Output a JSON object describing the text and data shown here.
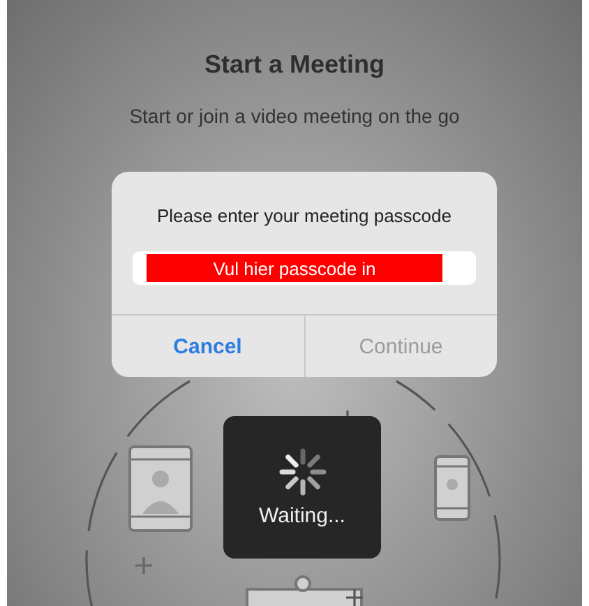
{
  "screen": {
    "title": "Start a Meeting",
    "subtitle": "Start or join a video meeting on the go"
  },
  "dialog": {
    "message": "Please enter your meeting passcode",
    "passcode_field": {
      "annotation": "Vul hier passcode in"
    },
    "buttons": [
      {
        "label": "Cancel",
        "disabled": false
      },
      {
        "label": "Continue",
        "disabled": true
      }
    ]
  },
  "loading": {
    "label": "Waiting..."
  }
}
